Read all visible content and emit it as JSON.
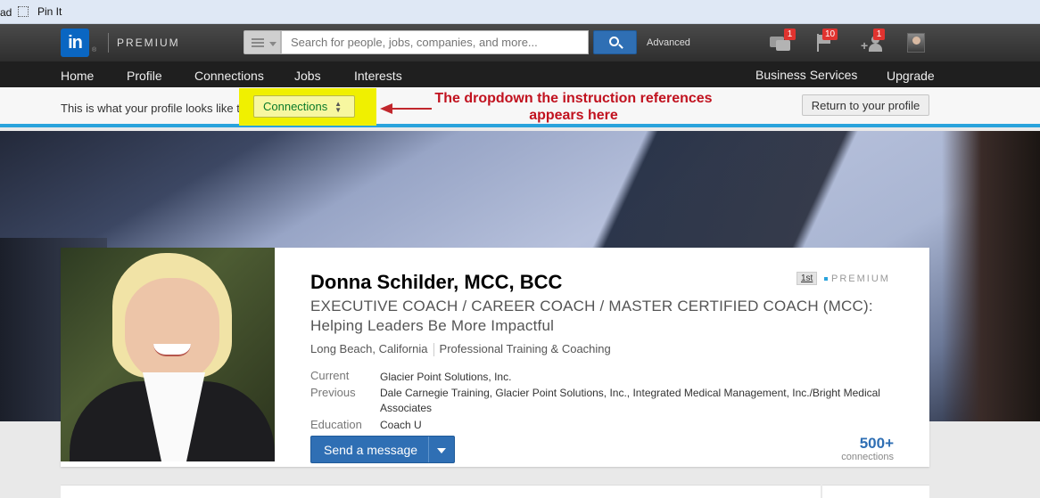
{
  "browser": {
    "bookmark_left": "ad",
    "bookmark_pin": "Pin It"
  },
  "header": {
    "logo_text": "in",
    "premium_label": "PREMIUM",
    "search": {
      "placeholder": "Search for people, jobs, companies, and more..."
    },
    "advanced_label": "Advanced",
    "messages_badge": "1",
    "notifications_badge": "10",
    "add_connections_badge": "1"
  },
  "nav": {
    "items": [
      "Home",
      "Profile",
      "Connections",
      "Jobs",
      "Interests"
    ],
    "business_services": "Business Services",
    "upgrade": "Upgrade"
  },
  "viewas": {
    "label": "This is what your profile looks like to",
    "selected": "Connections",
    "return_button": "Return to your profile"
  },
  "annotation": {
    "line1": "The dropdown the instruction references",
    "line2": "appears here",
    "color": "#c1121f"
  },
  "profile": {
    "name": "Donna Schilder, MCC, BCC",
    "degree": "1st",
    "premium": "PREMIUM",
    "headline": "EXECUTIVE COACH / CAREER COACH / MASTER CERTIFIED COACH (MCC): Helping Leaders Be More Impactful",
    "location": "Long Beach, California",
    "industry": "Professional Training & Coaching",
    "current_label": "Current",
    "current_value": "Glacier Point Solutions, Inc.",
    "previous_label": "Previous",
    "previous_value": "Dale Carnegie Training, Glacier Point Solutions, Inc., Integrated Medical Management, Inc./Bright Medical Associates",
    "education_label": "Education",
    "education_value": "Coach U",
    "send_message": "Send a message",
    "connections_count": "500+",
    "connections_label": "connections"
  },
  "colors": {
    "brand_blue": "#0a66c2",
    "button_blue": "#2f6fb4",
    "accent_bar": "#2aa3dc",
    "highlight": "#f0f000",
    "badge_red": "#e0332f"
  }
}
